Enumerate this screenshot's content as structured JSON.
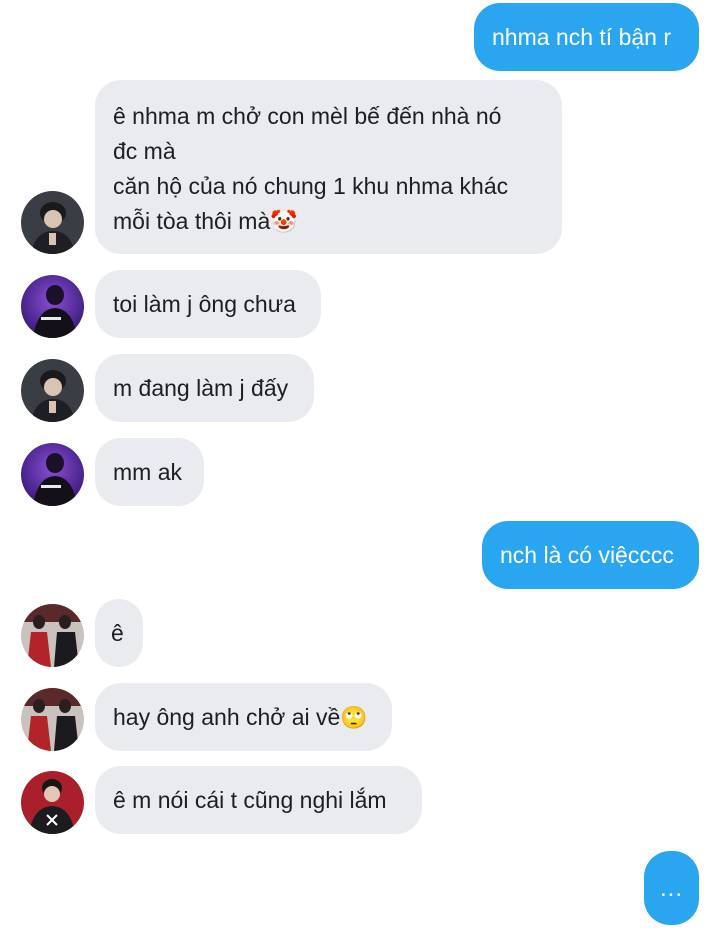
{
  "messages": [
    {
      "side": "sent",
      "lines": [
        "nhma nch tí bận r"
      ]
    },
    {
      "side": "recv",
      "lines": [
        "ê nhma m chở con mèl bế đến nhà nó",
        "đc mà",
        "căn hộ của nó chung 1 khu nhma khác",
        "mỗi tòa thôi mà"
      ],
      "emoji": "🤡",
      "avatar": "avatar-dark-hair"
    },
    {
      "side": "recv",
      "lines": [
        "toi làm j ông chưa"
      ],
      "avatar": "avatar-purple"
    },
    {
      "side": "recv",
      "lines": [
        "m đang làm j đấy"
      ],
      "avatar": "avatar-dark-hair"
    },
    {
      "side": "recv",
      "lines": [
        "mm ak"
      ],
      "avatar": "avatar-purple"
    },
    {
      "side": "sent",
      "lines": [
        "nch là có việcccc"
      ]
    },
    {
      "side": "recv",
      "lines": [
        "ê"
      ],
      "avatar": "avatar-group-red"
    },
    {
      "side": "recv",
      "lines": [
        "hay ông anh chở ai về"
      ],
      "emoji": "🙄",
      "avatar": "avatar-group-red"
    },
    {
      "side": "recv",
      "lines": [
        "ê m nói cái t cũng nghi lắm"
      ],
      "avatar": "avatar-jersey"
    },
    {
      "side": "sent",
      "lines": [
        "..."
      ]
    }
  ],
  "colors": {
    "sent_bubble": "#2aa6f0",
    "received_bubble": "#e9ebee",
    "sent_text": "#ffffff",
    "received_text": "#1c1e21"
  }
}
